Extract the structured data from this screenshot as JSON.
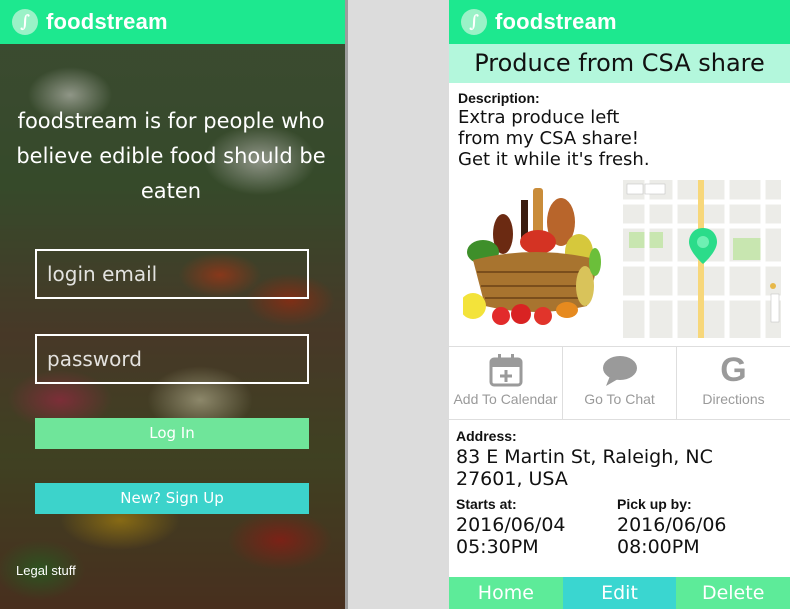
{
  "brand": {
    "name": "foodstream",
    "logo_glyph": "∫"
  },
  "colors": {
    "header_green": "#1de88f",
    "title_mint": "#b3f7dc",
    "login_button": "#6fe59a",
    "signup_button": "#3cd3cb",
    "nav_home": "#5deb99",
    "nav_edit": "#3ad6d0",
    "nav_delete": "#5deb99",
    "action_icon_gray": "#9a9a9a"
  },
  "login": {
    "tagline": "foodstream is for people who believe edible food should be eaten",
    "email_placeholder": "login email",
    "password_placeholder": "password",
    "login_button": "Log In",
    "signup_button": "New? Sign Up",
    "legal_link": "Legal stuff"
  },
  "event": {
    "title": "Produce from CSA share",
    "description_label": "Description:",
    "description_lines": [
      "Extra produce left",
      "from my CSA share!",
      "Get it while it's fresh."
    ],
    "actions": [
      {
        "label": "Add To Calendar",
        "icon": "calendar-add-icon"
      },
      {
        "label": "Go To Chat",
        "icon": "chat-bubble-icon"
      },
      {
        "label": "Directions",
        "icon": "google-g-icon",
        "glyph": "G"
      }
    ],
    "address_label": "Address:",
    "address_lines": [
      "83 E Martin St, Raleigh, NC",
      "27601, USA"
    ],
    "starts_label": "Starts at:",
    "starts_date": "2016/06/04",
    "starts_time": "05:30PM",
    "pickup_label": "Pick up by:",
    "pickup_date": "2016/06/06",
    "pickup_time": "08:00PM"
  },
  "bottom_nav": [
    {
      "label": "Home"
    },
    {
      "label": "Edit"
    },
    {
      "label": "Delete"
    }
  ]
}
